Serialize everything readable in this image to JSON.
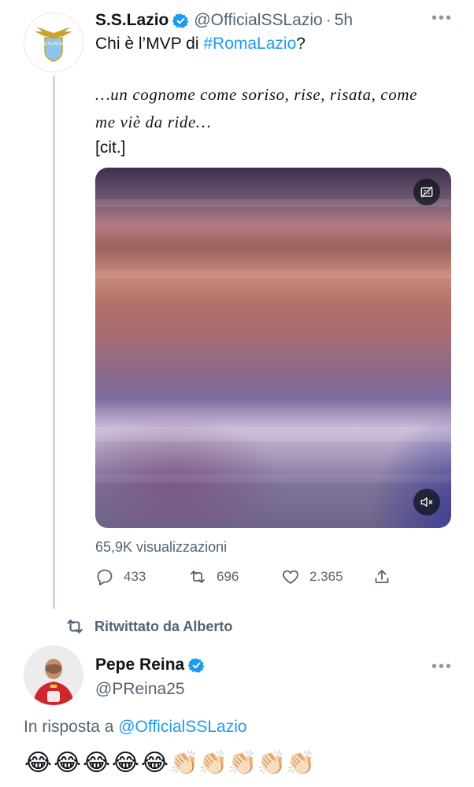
{
  "tweet1": {
    "author_name": "S.S.Lazio",
    "handle": "@OfficialSSLazio",
    "separator": "·",
    "time": "5h",
    "avatar_logo_text": "S.S.LAZIO",
    "text_before_link": "Chi è l’MVP di ",
    "hashtag": "#RomaLazio",
    "text_after_link": "?",
    "quote_line1": "…un cognome come soriso, rise, risata, come",
    "quote_line2": "me viè da ride…",
    "citation": "[cit.]",
    "views": "65,9K visualizzazioni",
    "replies": "433",
    "retweets": "696",
    "likes": "2.365",
    "more_icon": "•••"
  },
  "retweet_banner": {
    "label": "Ritwittato da Alberto"
  },
  "tweet2": {
    "author_name": "Pepe Reina",
    "handle": "@PReina25",
    "reply_prefix": "In risposta a ",
    "reply_to": "@OfficialSSLazio",
    "more_icon": "•••",
    "emoji_line": [
      "😂",
      "😂",
      "😂",
      "😂",
      "😂",
      "👏🏻",
      "👏🏻",
      "👏🏻",
      "👏🏻",
      "👏🏻"
    ]
  },
  "colors": {
    "accent": "#1d9bf0",
    "secondary_text": "#536471",
    "primary_text": "#0f1419"
  }
}
